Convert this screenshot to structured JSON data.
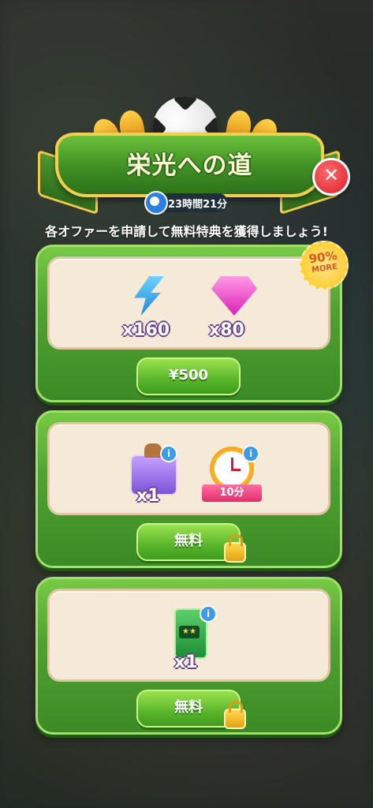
{
  "header": {
    "title": "栄光への道",
    "timer": "23時間21分",
    "subtitle": "各オファーを申請して無料特典を獲得しましょう!"
  },
  "badge": {
    "percent": "90%",
    "label": "MORE"
  },
  "offers": [
    {
      "items": [
        {
          "icon": "energy-bolt-icon",
          "qty": "x160"
        },
        {
          "icon": "pink-gem-icon",
          "qty": "x80"
        }
      ],
      "button": "¥500",
      "locked": false
    },
    {
      "items": [
        {
          "icon": "purple-chest-icon",
          "qty": "x1"
        },
        {
          "icon": "stopwatch-icon",
          "qty": "10分"
        }
      ],
      "button": "無料",
      "locked": true
    },
    {
      "items": [
        {
          "icon": "green-ticket-icon",
          "qty": "x1"
        }
      ],
      "button": "無料",
      "locked": true
    }
  ]
}
